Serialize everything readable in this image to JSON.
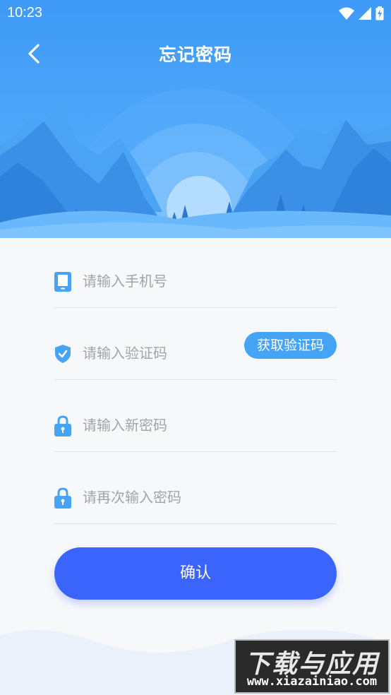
{
  "status_bar": {
    "time": "10:23"
  },
  "header": {
    "title": "忘记密码",
    "back_icon": "chevron-left-icon"
  },
  "form": {
    "phone": {
      "placeholder": "请输入手机号",
      "value": "",
      "icon": "phone-icon"
    },
    "code": {
      "placeholder": "请输入验证码",
      "value": "",
      "icon": "shield-check-icon",
      "send_button_label": "获取验证码"
    },
    "new_password": {
      "placeholder": "请输入新密码",
      "value": "",
      "icon": "lock-icon"
    },
    "confirm_password": {
      "placeholder": "请再次输入密码",
      "value": "",
      "icon": "lock-icon"
    }
  },
  "actions": {
    "confirm_label": "确认"
  },
  "watermark": {
    "main_text": "下载与应用",
    "sub_text": "www.xiazainiao.com"
  },
  "colors": {
    "header_blue": "#3d9cf6",
    "accent_blue": "#3a64fb",
    "icon_blue": "#46a4f6",
    "background": "#f7f8fa"
  }
}
